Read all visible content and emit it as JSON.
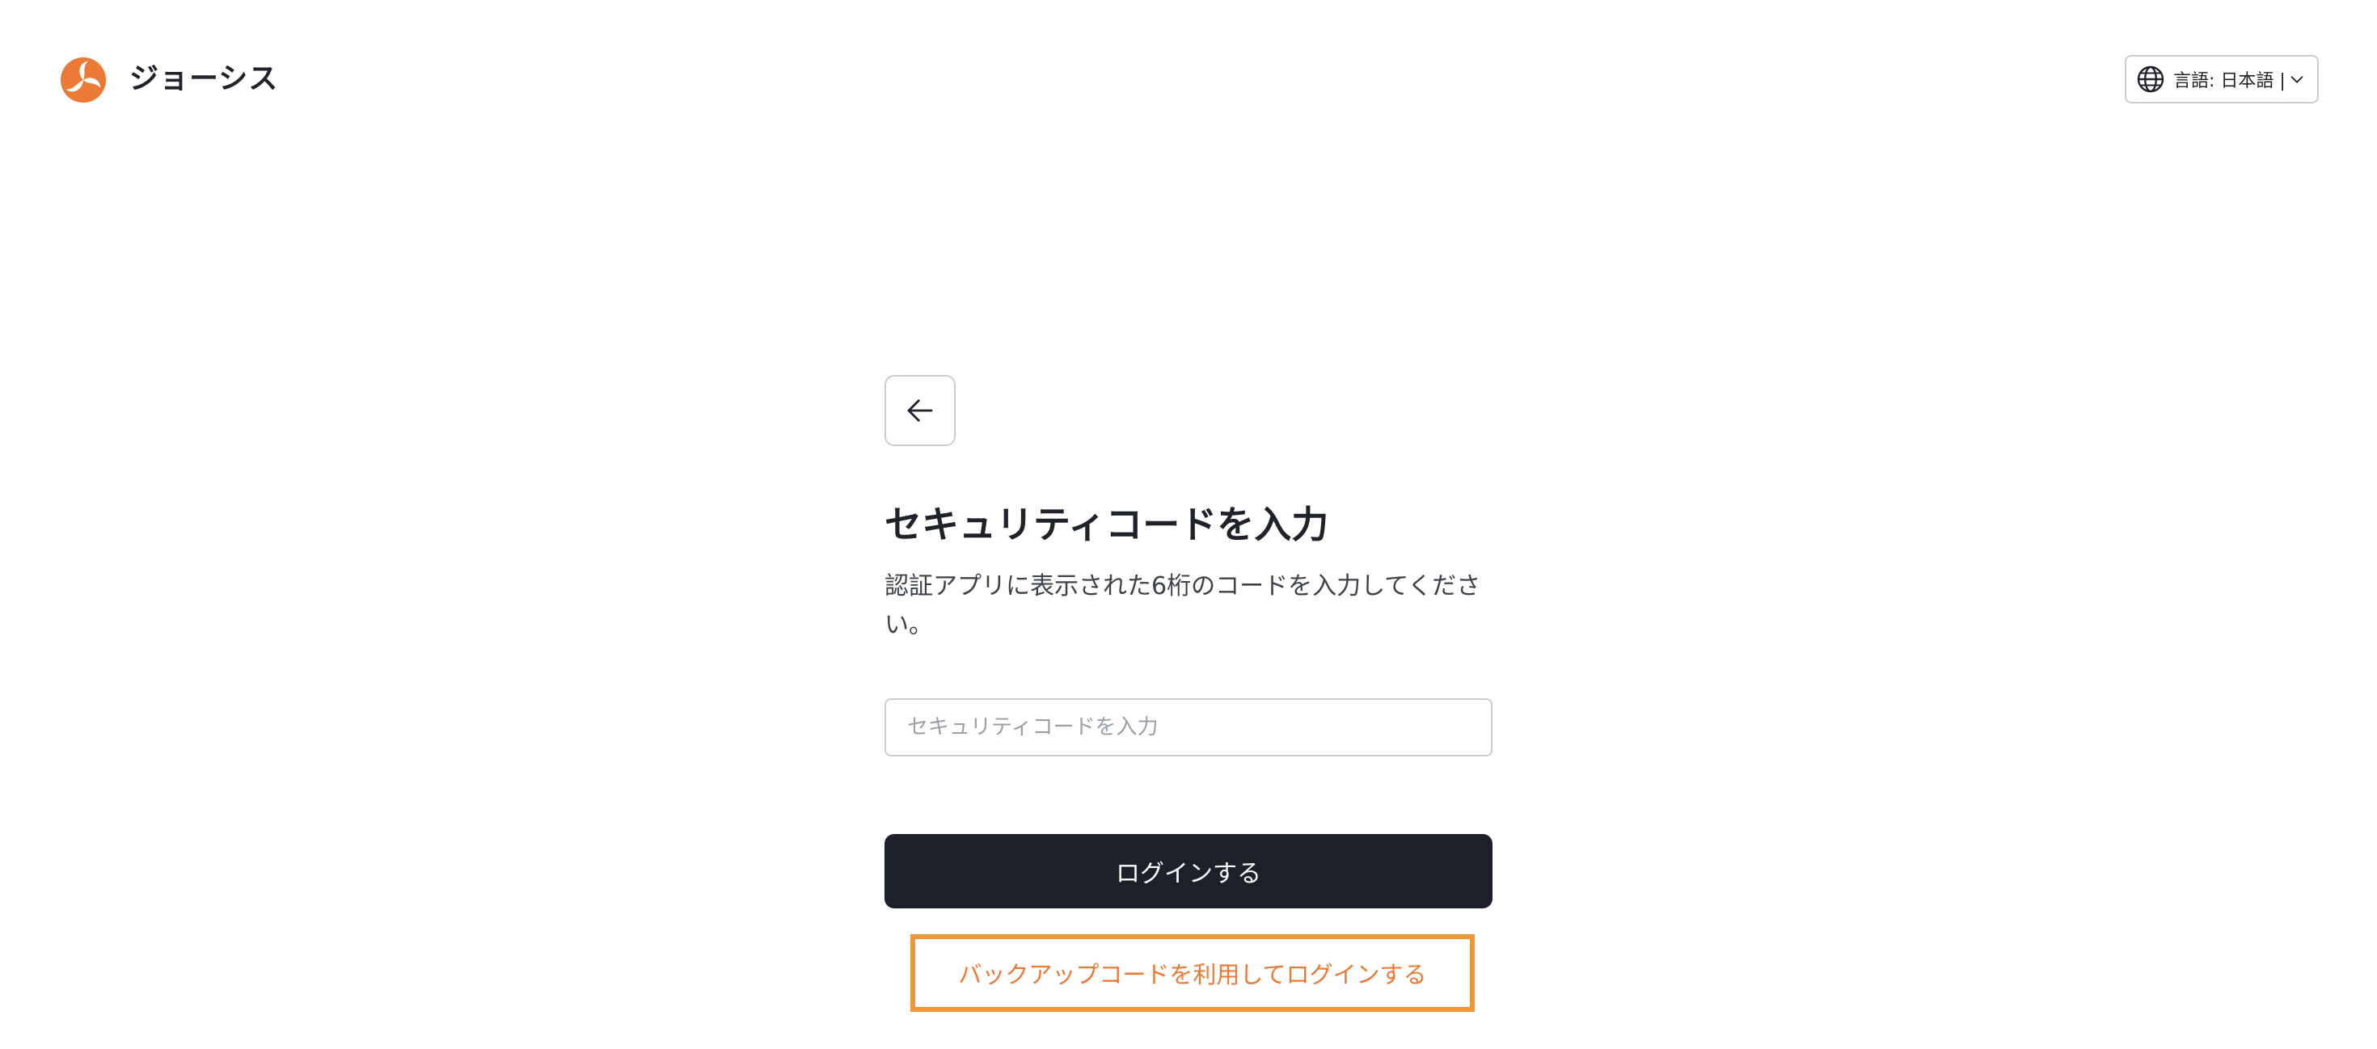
{
  "header": {
    "brand_name": "ジョーシス",
    "logo_icon": "joshys-swirl-logo",
    "language_button_label": "言語: 日本語 | ",
    "globe_icon": "globe-icon",
    "chevron_icon": "chevron-down-icon"
  },
  "form": {
    "back_icon": "arrow-left-icon",
    "title": "セキュリティコードを入力",
    "description": "認証アプリに表示された6桁のコードを入力してください。",
    "security_code_input": {
      "value": "",
      "placeholder": "セキュリティコードを入力"
    },
    "login_button_label": "ログインする",
    "backup_code_link_label": "バックアップコードを利用してログインする"
  },
  "colors": {
    "accent_orange": "#ec7a36",
    "highlight_border": "#f0973a",
    "primary_button": "#1b2029",
    "border_gray": "#c9cdd2"
  }
}
